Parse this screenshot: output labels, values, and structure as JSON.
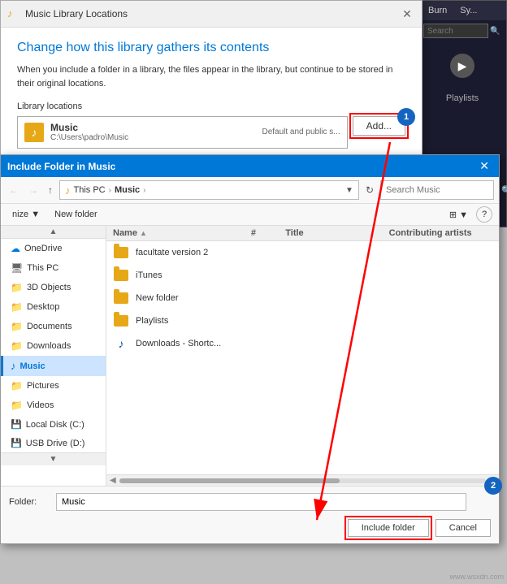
{
  "wmp": {
    "burn_label": "Burn",
    "sync_label": "Sy...",
    "playlists_label": "Playlists",
    "search_placeholder": "Search"
  },
  "library_dialog": {
    "title": "Music Library Locations",
    "heading": "Change how this library gathers its contents",
    "description": "When you include a folder in a library, the files appear in the library, but continue to be stored in their original locations.",
    "locations_label": "Library locations",
    "location_name": "Music",
    "location_path": "C:\\Users\\padro\\Music",
    "location_badge": "Default and public s...",
    "add_button": "Add...",
    "close_button": "✕"
  },
  "include_dialog": {
    "title": "Include Folder in Music",
    "close_button": "✕",
    "address": {
      "back_disabled": true,
      "up_label": "↑",
      "path_parts": [
        "This PC",
        "Music"
      ],
      "music_icon": "♪",
      "search_placeholder": "Search Music",
      "refresh_label": "⟳"
    },
    "toolbar": {
      "organize_label": "nize ▼",
      "new_folder_label": "New folder",
      "view_label": "⊞ ▼",
      "help_label": "?"
    },
    "nav_pane": {
      "scroll_up": "▲",
      "scroll_down": "▼",
      "items": [
        {
          "label": "OneDrive",
          "icon": "☁",
          "active": false,
          "border": false
        },
        {
          "label": "This PC",
          "icon": "💻",
          "active": false,
          "border": false
        },
        {
          "label": "3D Objects",
          "icon": "📁",
          "active": false,
          "border": false
        },
        {
          "label": "Desktop",
          "icon": "📁",
          "active": false,
          "border": false
        },
        {
          "label": "Documents",
          "icon": "📁",
          "active": false,
          "border": false
        },
        {
          "label": "Downloads",
          "icon": "📁",
          "active": false,
          "border": false
        },
        {
          "label": "Music",
          "icon": "♪",
          "active": true,
          "border": true
        },
        {
          "label": "Pictures",
          "icon": "📁",
          "active": false,
          "border": false
        },
        {
          "label": "Videos",
          "icon": "📁",
          "active": false,
          "border": false
        },
        {
          "label": "Local Disk (C:)",
          "icon": "💾",
          "active": false,
          "border": false
        },
        {
          "label": "USB Drive (D:)",
          "icon": "💾",
          "active": false,
          "border": false
        }
      ]
    },
    "file_list": {
      "headers": {
        "name": "Name",
        "number": "#",
        "title": "Title",
        "contributing": "Contributing artists"
      },
      "files": [
        {
          "name": "facultate version 2",
          "type": "folder",
          "icon": "folder-yellow"
        },
        {
          "name": "iTunes",
          "type": "folder",
          "icon": "folder-yellow"
        },
        {
          "name": "New folder",
          "type": "folder",
          "icon": "folder-yellow"
        },
        {
          "name": "Playlists",
          "type": "folder",
          "icon": "folder-yellow"
        },
        {
          "name": "Downloads - Shortc...",
          "type": "shortcut",
          "icon": "shortcut-music"
        }
      ]
    },
    "bottom": {
      "folder_label": "Folder:",
      "folder_value": "Music",
      "include_button": "Include folder",
      "cancel_button": "Cancel"
    }
  },
  "annotations": {
    "step1_label": "1",
    "step2_label": "2"
  },
  "watermark": "www.wsxdn.com"
}
